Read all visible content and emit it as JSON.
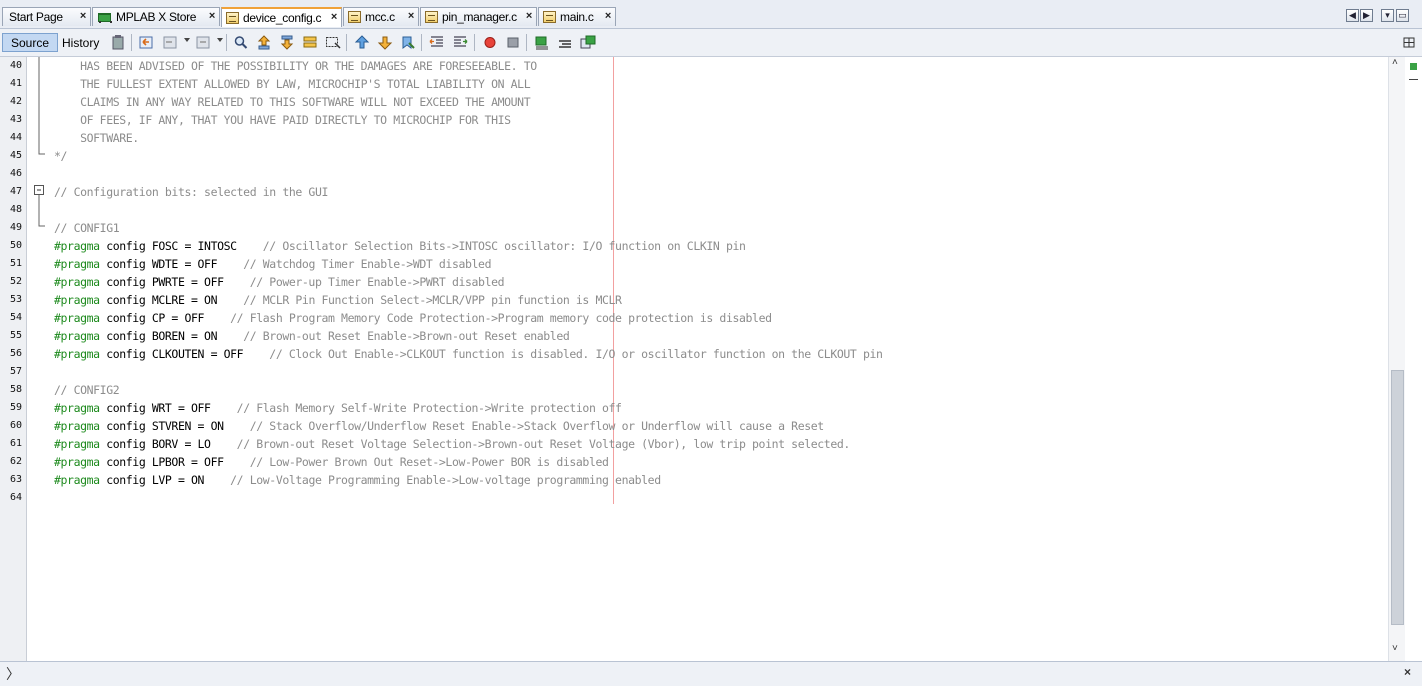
{
  "tabs": [
    {
      "label": "Start Page",
      "icon": "none",
      "active": false
    },
    {
      "label": "MPLAB X Store",
      "icon": "store-cart-icon",
      "active": false
    },
    {
      "label": "device_config.c",
      "icon": "c-file-icon",
      "active": true
    },
    {
      "label": "mcc.c",
      "icon": "c-file-icon",
      "active": false
    },
    {
      "label": "pin_manager.c",
      "icon": "c-file-icon",
      "active": false
    },
    {
      "label": "main.c",
      "icon": "c-file-icon",
      "active": false
    }
  ],
  "close_glyph": "×",
  "window_controls": {
    "left": "◀",
    "right": "▶",
    "menu": "▾",
    "restore": "▭"
  },
  "toolbar": {
    "source_label": "Source",
    "history_label": "History"
  },
  "editor": {
    "accent_keyword": "#1d8a1d",
    "comment_color": "#8c8c8c",
    "lines": [
      {
        "n": "40",
        "segs": [
          {
            "t": "    HAS BEEN ADVISED OF THE POSSIBILITY OR THE DAMAGES ARE FORESEEABLE. TO",
            "c": "cmt"
          }
        ]
      },
      {
        "n": "41",
        "segs": [
          {
            "t": "    THE FULLEST EXTENT ALLOWED BY LAW, MICROCHIP'S TOTAL LIABILITY ON ALL",
            "c": "cmt"
          }
        ]
      },
      {
        "n": "42",
        "segs": [
          {
            "t": "    CLAIMS IN ANY WAY RELATED TO THIS SOFTWARE WILL NOT EXCEED THE AMOUNT",
            "c": "cmt"
          }
        ]
      },
      {
        "n": "43",
        "segs": [
          {
            "t": "    OF FEES, IF ANY, THAT YOU HAVE PAID DIRECTLY TO MICROCHIP FOR THIS",
            "c": "cmt"
          }
        ]
      },
      {
        "n": "44",
        "segs": [
          {
            "t": "    SOFTWARE.",
            "c": "cmt"
          }
        ]
      },
      {
        "n": "45",
        "segs": [
          {
            "t": "*/",
            "c": "cmt"
          }
        ]
      },
      {
        "n": "46",
        "segs": []
      },
      {
        "n": "47",
        "segs": [
          {
            "t": "// Configuration bits: selected in the GUI",
            "c": "cmt"
          }
        ]
      },
      {
        "n": "48",
        "segs": []
      },
      {
        "n": "49",
        "segs": [
          {
            "t": "// CONFIG1",
            "c": "cmt"
          }
        ]
      },
      {
        "n": "50",
        "segs": [
          {
            "t": "#pragma",
            "c": "kw"
          },
          {
            "t": " config FOSC = INTOSC    ",
            "c": "pl"
          },
          {
            "t": "// Oscillator Selection Bits->INTOSC oscillator: I/O function on CLKIN pin",
            "c": "cmt"
          }
        ]
      },
      {
        "n": "51",
        "segs": [
          {
            "t": "#pragma",
            "c": "kw"
          },
          {
            "t": " config WDTE = OFF    ",
            "c": "pl"
          },
          {
            "t": "// Watchdog Timer Enable->WDT disabled",
            "c": "cmt"
          }
        ]
      },
      {
        "n": "52",
        "segs": [
          {
            "t": "#pragma",
            "c": "kw"
          },
          {
            "t": " config PWRTE = OFF    ",
            "c": "pl"
          },
          {
            "t": "// Power-up Timer Enable->PWRT disabled",
            "c": "cmt"
          }
        ]
      },
      {
        "n": "53",
        "segs": [
          {
            "t": "#pragma",
            "c": "kw"
          },
          {
            "t": " config MCLRE = ON    ",
            "c": "pl"
          },
          {
            "t": "// MCLR Pin Function Select->MCLR/VPP pin function is MCLR",
            "c": "cmt"
          }
        ]
      },
      {
        "n": "54",
        "segs": [
          {
            "t": "#pragma",
            "c": "kw"
          },
          {
            "t": " config CP = OFF    ",
            "c": "pl"
          },
          {
            "t": "// Flash Program Memory Code Protection->Program memory code protection is disabled",
            "c": "cmt"
          }
        ]
      },
      {
        "n": "55",
        "segs": [
          {
            "t": "#pragma",
            "c": "kw"
          },
          {
            "t": " config BOREN = ON    ",
            "c": "pl"
          },
          {
            "t": "// Brown-out Reset Enable->Brown-out Reset enabled",
            "c": "cmt"
          }
        ]
      },
      {
        "n": "56",
        "segs": [
          {
            "t": "#pragma",
            "c": "kw"
          },
          {
            "t": " config CLKOUTEN = OFF    ",
            "c": "pl"
          },
          {
            "t": "// Clock Out Enable->CLKOUT function is disabled. I/O or oscillator function on the CLKOUT pin",
            "c": "cmt"
          }
        ]
      },
      {
        "n": "57",
        "segs": []
      },
      {
        "n": "58",
        "segs": [
          {
            "t": "// CONFIG2",
            "c": "cmt"
          }
        ]
      },
      {
        "n": "59",
        "segs": [
          {
            "t": "#pragma",
            "c": "kw"
          },
          {
            "t": " config WRT = OFF    ",
            "c": "pl"
          },
          {
            "t": "// Flash Memory Self-Write Protection->Write protection off",
            "c": "cmt"
          }
        ]
      },
      {
        "n": "60",
        "segs": [
          {
            "t": "#pragma",
            "c": "kw"
          },
          {
            "t": " config STVREN = ON    ",
            "c": "pl"
          },
          {
            "t": "// Stack Overflow/Underflow Reset Enable->Stack Overflow or Underflow will cause a Reset",
            "c": "cmt"
          }
        ]
      },
      {
        "n": "61",
        "segs": [
          {
            "t": "#pragma",
            "c": "kw"
          },
          {
            "t": " config BORV = LO    ",
            "c": "pl"
          },
          {
            "t": "// Brown-out Reset Voltage Selection->Brown-out Reset Voltage (Vbor), low trip point selected.",
            "c": "cmt"
          }
        ]
      },
      {
        "n": "62",
        "segs": [
          {
            "t": "#pragma",
            "c": "kw"
          },
          {
            "t": " config LPBOR = OFF    ",
            "c": "pl"
          },
          {
            "t": "// Low-Power Brown Out Reset->Low-Power BOR is disabled",
            "c": "cmt"
          }
        ]
      },
      {
        "n": "63",
        "segs": [
          {
            "t": "#pragma",
            "c": "kw"
          },
          {
            "t": " config LVP = ON    ",
            "c": "pl"
          },
          {
            "t": "// Low-Voltage Programming Enable->Low-voltage programming enabled",
            "c": "cmt"
          }
        ]
      },
      {
        "n": "64",
        "segs": []
      }
    ]
  },
  "scrollbar": {
    "up": "˄",
    "down": "˅"
  },
  "bottom": {
    "expand_glyph": "〉",
    "close_glyph": "×"
  }
}
